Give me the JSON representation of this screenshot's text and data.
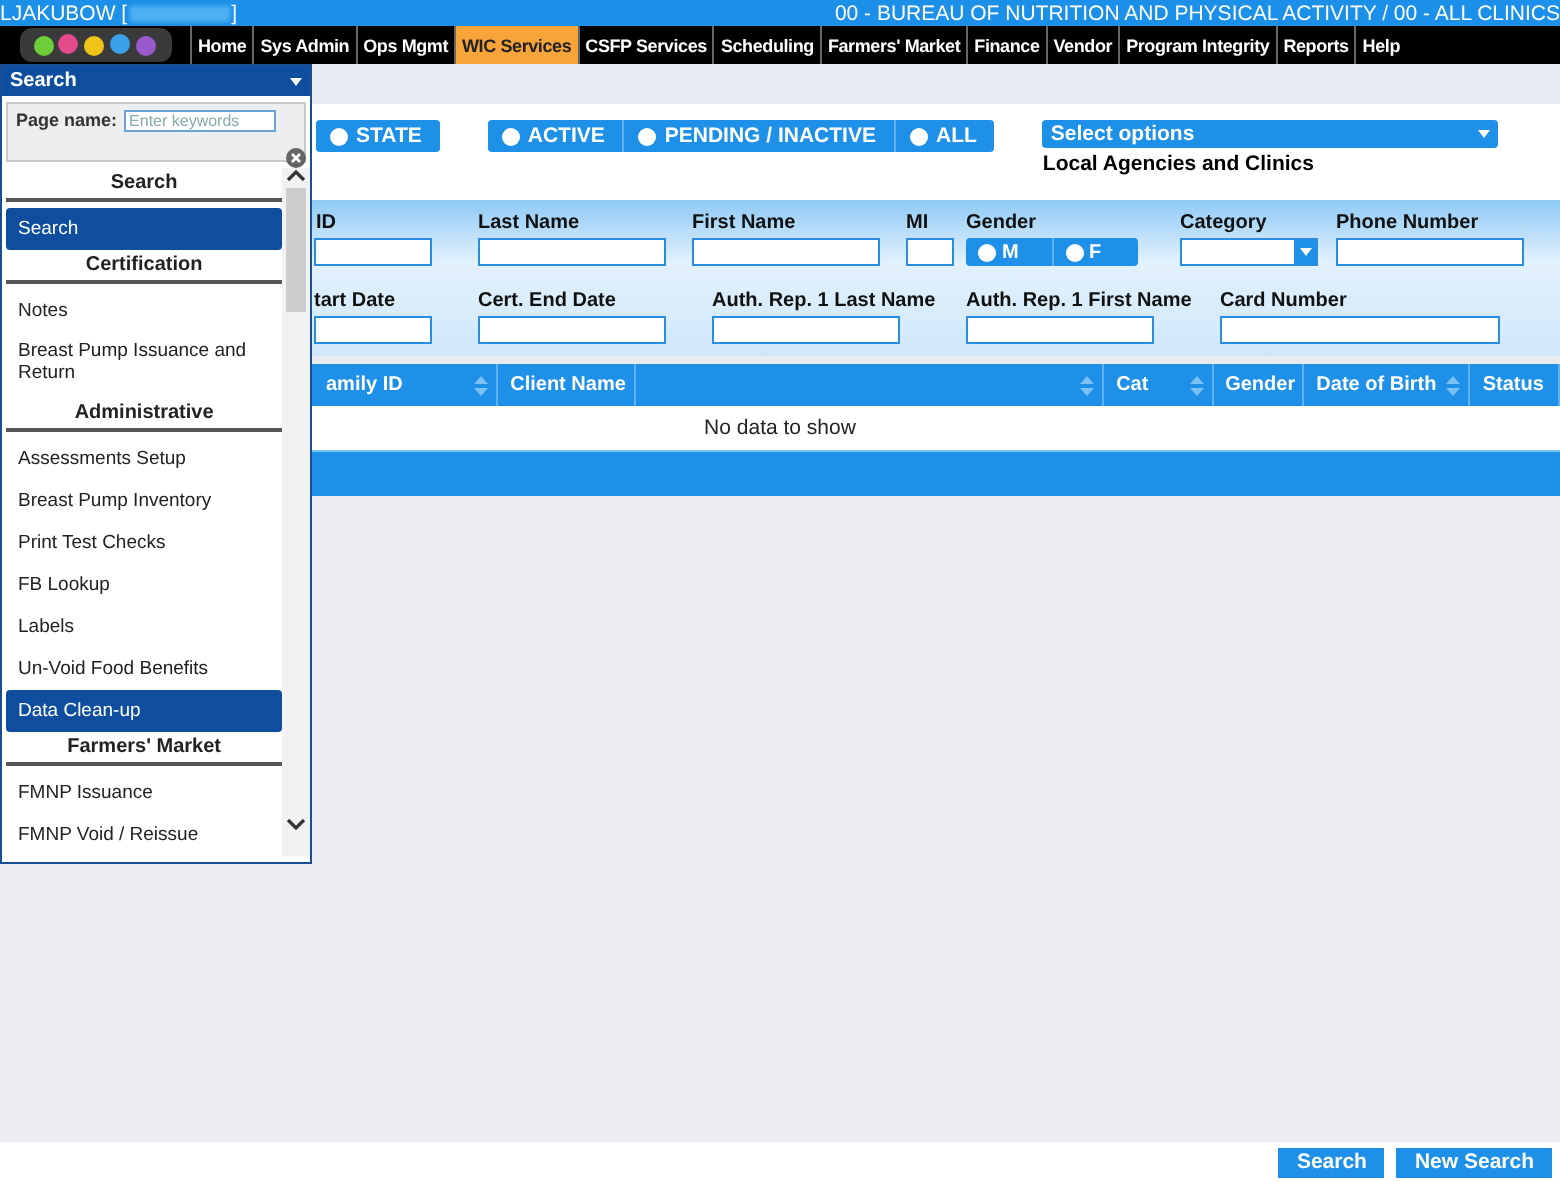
{
  "header": {
    "user": "LJAKUBOW [",
    "user_end": "]",
    "location": "00 - BUREAU OF NUTRITION AND PHYSICAL ACTIVITY / 00 - ALL CLINICS"
  },
  "nav": [
    {
      "label": "Home",
      "selected": false
    },
    {
      "label": "Sys Admin",
      "selected": false
    },
    {
      "label": "Ops Mgmt",
      "selected": false
    },
    {
      "label": "WIC Services",
      "selected": true
    },
    {
      "label": "CSFP Services",
      "selected": false
    },
    {
      "label": "Scheduling",
      "selected": false
    },
    {
      "label": "Farmers' Market",
      "selected": false
    },
    {
      "label": "Finance",
      "selected": false
    },
    {
      "label": "Vendor",
      "selected": false
    },
    {
      "label": "Program Integrity",
      "selected": false
    },
    {
      "label": "Reports",
      "selected": false
    },
    {
      "label": "Help",
      "selected": false
    }
  ],
  "menu": {
    "title": "Search",
    "page_name_label": "Page name:",
    "page_name": {
      "placeholder": "Enter keywords"
    },
    "items": [
      {
        "kind": "header",
        "label": "Search"
      },
      {
        "kind": "item",
        "label": "Search",
        "selected": true
      },
      {
        "kind": "header",
        "label": "Certification"
      },
      {
        "kind": "item",
        "label": "Notes",
        "selected": false
      },
      {
        "kind": "item",
        "label": "Breast Pump Issuance and Return",
        "selected": false
      },
      {
        "kind": "header",
        "label": "Administrative"
      },
      {
        "kind": "item",
        "label": "Assessments Setup",
        "selected": false
      },
      {
        "kind": "item",
        "label": "Breast Pump Inventory",
        "selected": false
      },
      {
        "kind": "item",
        "label": "Print Test Checks",
        "selected": false
      },
      {
        "kind": "item",
        "label": "FB Lookup",
        "selected": false
      },
      {
        "kind": "item",
        "label": "Labels",
        "selected": false
      },
      {
        "kind": "item",
        "label": "Un-Void Food Benefits",
        "selected": false
      },
      {
        "kind": "item",
        "label": "Data Clean-up",
        "selected": true
      },
      {
        "kind": "header",
        "label": "Farmers' Market"
      },
      {
        "kind": "item",
        "label": "FMNP Issuance",
        "selected": false
      },
      {
        "kind": "item",
        "label": "FMNP Void / Reissue",
        "selected": false
      }
    ]
  },
  "filters": {
    "scope": [
      {
        "label": "STATE",
        "selected": false
      }
    ],
    "status": [
      {
        "label": "ACTIVE",
        "selected": false
      },
      {
        "label": "PENDING / INACTIVE",
        "selected": false
      },
      {
        "label": "ALL",
        "selected": false
      }
    ],
    "agencies": {
      "value": "Select options",
      "label": "Local Agencies and Clinics"
    }
  },
  "form": {
    "row_1": [
      {
        "kind": "text",
        "label": "ID"
      },
      {
        "kind": "text",
        "label": "Last Name"
      },
      {
        "kind": "text",
        "label": "First Name"
      },
      {
        "kind": "text",
        "label": "MI"
      },
      {
        "kind": "radio",
        "label": "Gender",
        "options": [
          {
            "label": "M",
            "selected": false
          },
          {
            "label": "F",
            "selected": false
          }
        ]
      },
      {
        "kind": "select",
        "label": "Category"
      },
      {
        "kind": "text",
        "label": "Phone Number"
      }
    ],
    "row_2": [
      {
        "kind": "text",
        "label": "tart Date"
      },
      {
        "kind": "text",
        "label": "Cert. End Date"
      },
      {
        "kind": "text",
        "label": "Auth. Rep. 1 Last Name"
      },
      {
        "kind": "text",
        "label": "Auth. Rep. 1 First Name"
      },
      {
        "kind": "text",
        "label": "Card Number"
      }
    ]
  },
  "table": {
    "columns": [
      {
        "label": "amily ID",
        "sortable": true
      },
      {
        "label": "Client Name",
        "sortable": false
      },
      {
        "sortable": true
      },
      {
        "label": "Cat",
        "sortable": true
      },
      {
        "label": "Gender",
        "sortable": false
      },
      {
        "label": "Date of Birth",
        "sortable": true
      },
      {
        "label": "Status",
        "sortable": false
      }
    ],
    "empty_message": "No data to show"
  },
  "buttons": [
    "Search",
    "New Search"
  ]
}
